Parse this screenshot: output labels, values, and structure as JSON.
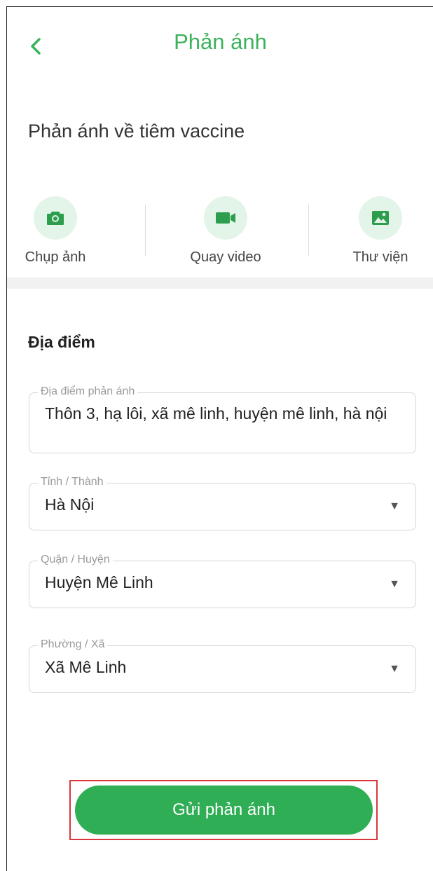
{
  "header": {
    "title": "Phản ánh"
  },
  "subtitle": "Phản ánh về tiêm vaccine",
  "media": [
    {
      "label": "Chụp ảnh",
      "icon": "camera-icon"
    },
    {
      "label": "Quay video",
      "icon": "video-camera-icon"
    },
    {
      "label": "Thư viện",
      "icon": "gallery-icon"
    }
  ],
  "location": {
    "section_title": "Địa điểm",
    "address": {
      "label": "Địa điểm phản ánh",
      "value": "Thôn 3, hạ lôi, xã mê linh, huyện mê linh, hà nội"
    },
    "province": {
      "label": "Tỉnh / Thành",
      "value": "Hà Nội"
    },
    "district": {
      "label": "Quận / Huyện",
      "value": "Huyện Mê Linh"
    },
    "ward": {
      "label": "Phường / Xã",
      "value": "Xã Mê Linh"
    }
  },
  "submit_label": "Gửi phản ánh",
  "colors": {
    "accent": "#3cb25c",
    "button": "#2fae55",
    "icon_bg": "#e3f4e8",
    "highlight_border": "#d9363e"
  }
}
